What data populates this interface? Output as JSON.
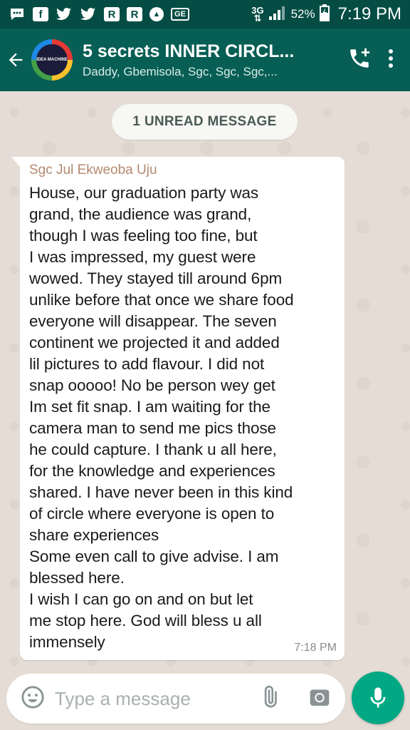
{
  "status_bar": {
    "network_type": "3G",
    "battery": "52%",
    "time": "7:19 PM",
    "icons": [
      "messages-icon",
      "facebook-icon",
      "twitter-icon",
      "twitter-icon",
      "app-r-icon",
      "app-r-icon",
      "upload-icon",
      "ge-icon"
    ],
    "icon_glyphs": {
      "facebook": "f",
      "app_r": "R",
      "ge": "GE"
    }
  },
  "header": {
    "group_name": "5 secrets INNER CIRCL...",
    "members": "Daddy, Gbemisola, Sgc, Sgc, Sgc,...",
    "avatar_label": "IDEA MACHINE",
    "colors": {
      "bar": "#075e54",
      "status_bar": "#054d44"
    }
  },
  "chat": {
    "unread_label": "1 UNREAD MESSAGE",
    "messages": [
      {
        "sender": "Sgc Jul Ekweoba Uju",
        "sender_color": "#b58a6f",
        "text": "House, our graduation party was\ngrand, the audience was grand,\nthough I was feeling too fine, but\nI was impressed, my guest were\nwowed. They stayed till around 6pm\nunlike before that once we share food\neveryone will disappear. The seven\ncontinent we projected it and added\nlil pictures to add flavour. I did not\nsnap ooooo! No be person wey get\nIm set fit snap. I am waiting for the\ncamera man to send me pics those\nhe could capture. I thank u all here,\nfor the knowledge and experiences\nshared. I have never been in this kind\nof circle where everyone is open to\nshare experiences\nSome even call to give advise. I am\nblessed here.\nI wish I can go on and on but let\nme stop here. God will bless u all\nimmensely",
        "time": "7:18 PM"
      }
    ]
  },
  "composer": {
    "placeholder": "Type a message",
    "accent": "#00a884"
  }
}
